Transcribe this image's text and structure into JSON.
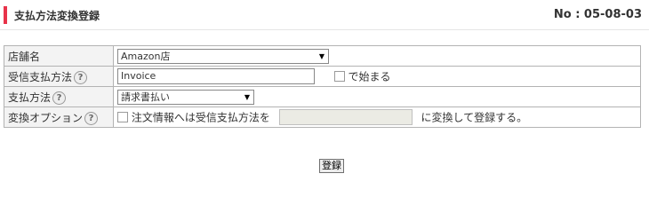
{
  "header": {
    "title": "支払方法変換登録",
    "page_no": "No : 05-08-03"
  },
  "form": {
    "store": {
      "label": "店舗名",
      "selected": "Amazon店"
    },
    "incoming_method": {
      "label": "受信支払方法",
      "value": "Invoice",
      "checkbox_label": "で始まる"
    },
    "payment_method": {
      "label": "支払方法",
      "selected": "請求書払い"
    },
    "conversion_option": {
      "label": "変換オプション",
      "text_before": "注文情報へは受信支払方法を",
      "text_after": "に変換して登録する。"
    }
  },
  "actions": {
    "submit_label": "登録"
  },
  "icons": {
    "help": "?",
    "dropdown": "▼"
  },
  "colors": {
    "accent": "#e8334a"
  }
}
